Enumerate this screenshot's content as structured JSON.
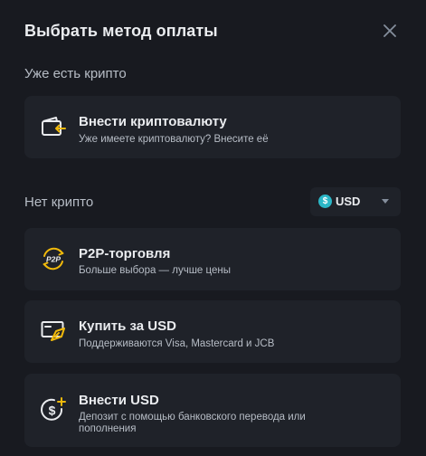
{
  "modal": {
    "title": "Выбрать метод оплаты",
    "close_icon": "close-icon"
  },
  "has_crypto": {
    "label": "Уже есть крипто",
    "card": {
      "icon": "wallet-deposit-icon",
      "title": "Внести криптовалюту",
      "subtitle": "Уже имеете криптовалюту? Внесите её"
    }
  },
  "no_crypto": {
    "label": "Нет крипто",
    "currency": {
      "symbol": "$",
      "code": "USD"
    },
    "options": [
      {
        "icon": "p2p-icon",
        "title": "P2P-торговля",
        "subtitle": "Больше выбора — лучше цены"
      },
      {
        "icon": "card-buy-icon",
        "title": "Купить за USD",
        "subtitle": "Поддерживаются Visa, Mastercard и JCB"
      },
      {
        "icon": "dollar-deposit-icon",
        "title": "Внести USD",
        "subtitle": "Депозит с помощью банковского перевода или пополнения"
      }
    ]
  },
  "colors": {
    "background": "#181a20",
    "card": "#1f2229",
    "accent": "#f0b90b",
    "text_primary": "#eaecef",
    "text_secondary": "#b7bdc6",
    "usd_coin": "#2bb7c7"
  }
}
